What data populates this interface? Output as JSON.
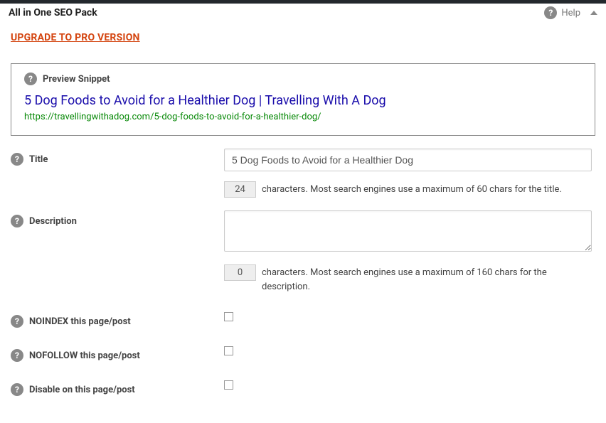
{
  "header": {
    "title": "All in One SEO Pack",
    "help": "Help"
  },
  "upgrade": "UPGRADE TO PRO VERSION",
  "preview": {
    "label": "Preview Snippet",
    "title": "5 Dog Foods to Avoid for a Healthier Dog | Travelling With A Dog",
    "url": "https://travellingwithadog.com/5-dog-foods-to-avoid-for-a-healthier-dog/"
  },
  "fields": {
    "title": {
      "label": "Title",
      "value": "5 Dog Foods to Avoid for a Healthier Dog",
      "count": "24",
      "hint": "characters. Most search engines use a maximum of 60 chars for the title."
    },
    "description": {
      "label": "Description",
      "value": "",
      "count": "0",
      "hint": "characters. Most search engines use a maximum of 160 chars for the description."
    },
    "noindex": {
      "label": "NOINDEX this page/post"
    },
    "nofollow": {
      "label": "NOFOLLOW this page/post"
    },
    "disable": {
      "label": "Disable on this page/post"
    }
  }
}
